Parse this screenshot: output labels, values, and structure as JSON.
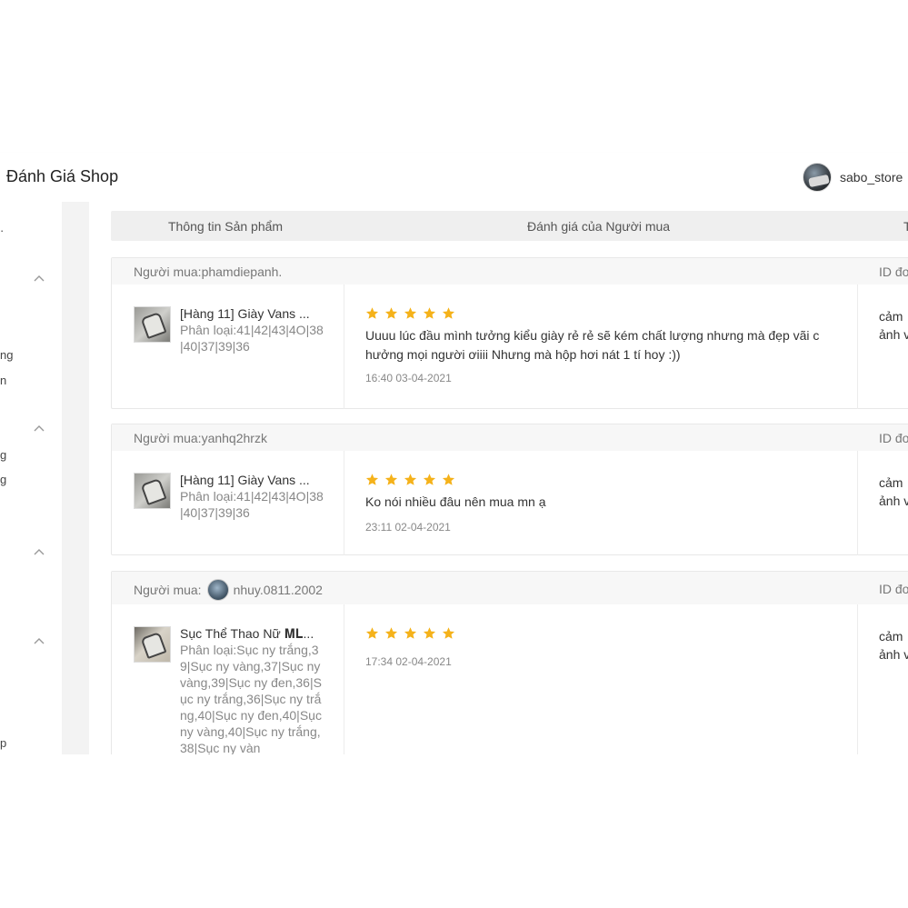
{
  "header": {
    "title": "Đánh Giá Shop",
    "username": "sabo_store"
  },
  "sidebar": {
    "fragments": [
      "ng",
      "n",
      "g",
      "g",
      "p"
    ]
  },
  "table": {
    "columns": [
      "Thông tin Sản phẩm",
      "Đánh giá của Người mua",
      "T"
    ]
  },
  "reviews": [
    {
      "buyer_label": "Người mua:phamdiepanh.",
      "order_label": "ID đơ",
      "product_name": "[Hàng 11] Giày Vans ...",
      "variation": "Phân loại:41|42|43|4O|38|40|37|39|36",
      "rating": 5,
      "comment": "Uuuu lúc đầu mình tưởng kiểu giày rẻ rẻ sẽ kém chất lượng nhưng mà đẹp vãi c hưởng mọi người ơiiii Nhưng mà hộp hơi nát 1 tí hoy :))",
      "time": "16:40 03-04-2021",
      "reply_line1": "cảm",
      "reply_line2": "ảnh v"
    },
    {
      "buyer_label": "Người mua:yanhq2hrzk",
      "order_label": "ID đơ",
      "product_name": "[Hàng 11] Giày Vans ...",
      "variation": "Phân loại:41|42|43|4O|38|40|37|39|36",
      "rating": 5,
      "comment": "Ko nói nhiều đâu nên mua mn ạ",
      "time": "23:11 02-04-2021",
      "reply_line1": "cảm",
      "reply_line2": "ảnh v"
    },
    {
      "buyer_prefix": "Người mua:",
      "buyer_name": "nhuy.0811.2002",
      "order_label": "ID đơ",
      "product_name": "Sục Thể Thao Nữ 𝐌𝐋...",
      "variation": "Phân loại:Sục ny trắng,39|Sục ny vàng,37|Sục ny vàng,39|Sục ny đen,36|Sục ny trắng,36|Sục ny trắng,40|Sục ny đen,40|Sục ny vàng,40|Sục ny trắng,38|Sục ny vàn",
      "rating": 5,
      "comment": "",
      "time": "17:34 02-04-2021",
      "reply_line1": "cảm",
      "reply_line2": "ảnh v"
    }
  ],
  "colors": {
    "star": "#f5b21a",
    "header_bg": "#efefef",
    "card_head_bg": "#f7f7f7"
  }
}
